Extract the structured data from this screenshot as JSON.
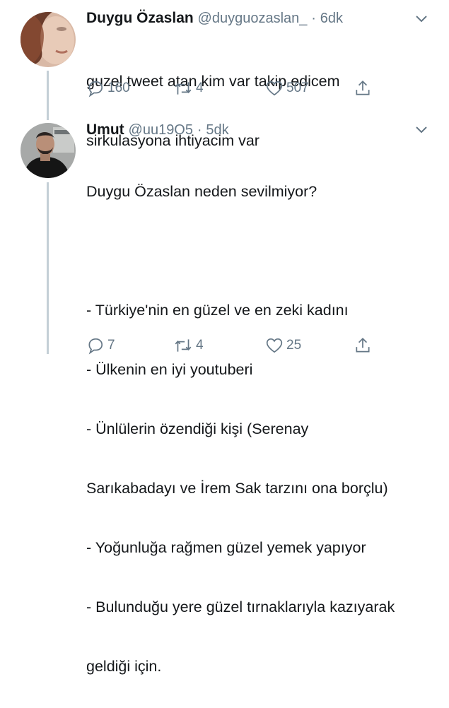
{
  "tweets": [
    {
      "name": "Duygu Özaslan",
      "handle": "@duyguozaslan_",
      "separator": "·",
      "time": "6dk",
      "lines": [
        "guzel tweet atan kim var takip edicem",
        "sirkulasyona ihtiyacim var"
      ],
      "replies": "160",
      "retweets": "4",
      "likes": "507"
    },
    {
      "name": "Umut",
      "handle": "@uu19O5",
      "separator": "·",
      "time": "5dk",
      "lines": [
        "Duygu Özaslan neden sevilmiyor?",
        "",
        "- Türkiye'nin en güzel ve en zeki kadını",
        "- Ülkenin en iyi youtuberi",
        "- Ünlülerin özendiği kişi (Serenay",
        "Sarıkabadayı ve İrem Sak tarzını ona borçlu)",
        "- Yoğunluğa rağmen güzel yemek yapıyor",
        "- Bulunduğu yere güzel tırnaklarıyla kazıyarak",
        "geldiği için."
      ],
      "replies": "7",
      "retweets": "4",
      "likes": "25"
    }
  ],
  "icons": {
    "reply": "reply-icon",
    "retweet": "retweet-icon",
    "like": "heart-icon",
    "share": "share-icon",
    "more": "chevron-down-icon"
  },
  "colors": {
    "text": "#14171a",
    "secondary": "#657786",
    "thread_line": "#c4cfd6"
  }
}
